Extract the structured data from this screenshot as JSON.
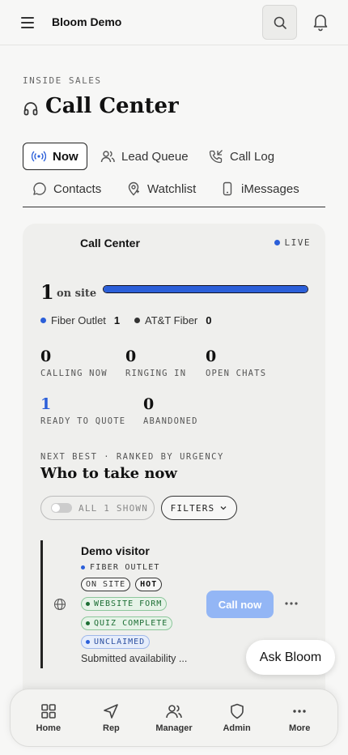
{
  "app": {
    "title": "Bloom Demo"
  },
  "header": {
    "eyebrow": "INSIDE SALES",
    "title": "Call Center"
  },
  "tabs": [
    {
      "label": "Now",
      "icon": "broadcast-icon",
      "active": true
    },
    {
      "label": "Lead Queue",
      "icon": "users-icon"
    },
    {
      "label": "Call Log",
      "icon": "phone-incoming-icon"
    },
    {
      "label": "Contacts",
      "icon": "chat-bubble-icon"
    },
    {
      "label": "Watchlist",
      "icon": "map-pin-icon"
    },
    {
      "label": "iMessages",
      "icon": "smartphone-icon"
    }
  ],
  "card": {
    "title": "Call Center",
    "live_label": "LIVE",
    "on_site": {
      "count": "1",
      "label": "on site",
      "fill_fraction": 1.0
    },
    "legend": [
      {
        "label": "Fiber Outlet",
        "count": "1",
        "color": "#2b5fd9"
      },
      {
        "label": "AT&T Fiber",
        "count": "0",
        "color": "#333333"
      }
    ],
    "stats": [
      {
        "value": "0",
        "label": "CALLING NOW"
      },
      {
        "value": "0",
        "label": "RINGING IN"
      },
      {
        "value": "0",
        "label": "OPEN CHATS"
      },
      {
        "value": "1",
        "label": "READY TO QUOTE",
        "color": "#2b5fd9"
      },
      {
        "value": "0",
        "label": "ABANDONED"
      }
    ],
    "section_eyebrow": "NEXT BEST · RANKED BY URGENCY",
    "section_title": "Who to take now",
    "toggle_label": "ALL 1 SHOWN",
    "filters_label": "FILTERS",
    "lead": {
      "name": "Demo visitor",
      "source": "FIBER OUTLET",
      "chips": [
        "ON SITE",
        "HOT"
      ],
      "green_tags": [
        "WEBSITE FORM",
        "QUIZ COMPLETE"
      ],
      "blue_tag": "UNCLAIMED",
      "note": "Submitted availability ...",
      "call_label": "Call now"
    }
  },
  "ask_bloom": "Ask Bloom",
  "nav": [
    {
      "label": "Home",
      "icon": "grid-icon"
    },
    {
      "label": "Rep",
      "icon": "send-icon"
    },
    {
      "label": "Manager",
      "icon": "users-icon"
    },
    {
      "label": "Admin",
      "icon": "shield-icon"
    },
    {
      "label": "More",
      "icon": "more-dots-icon"
    }
  ],
  "colors": {
    "accent": "#2b5fd9",
    "call_button": "#93b6f5"
  }
}
